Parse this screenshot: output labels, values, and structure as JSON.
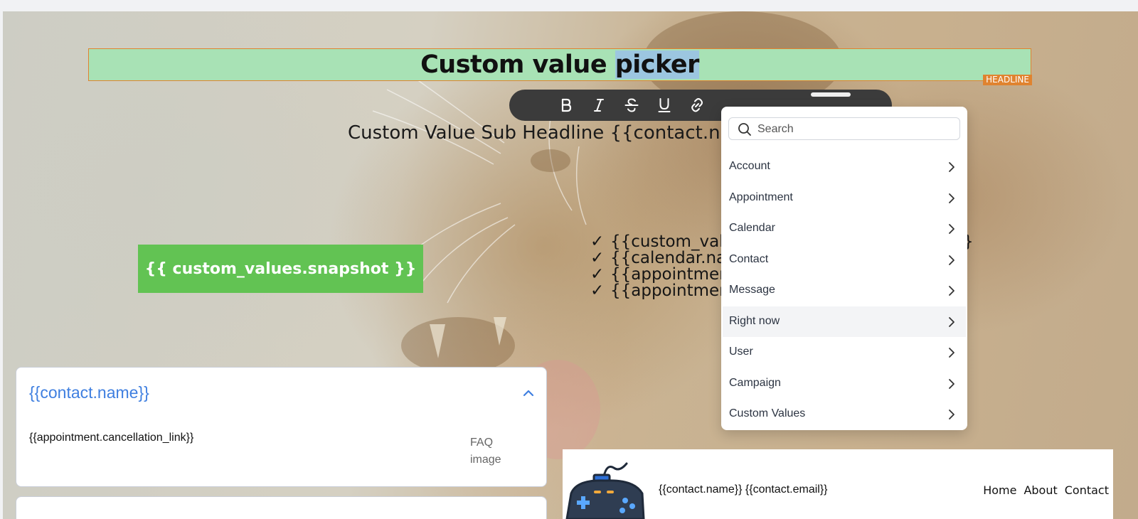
{
  "headline": {
    "text_before": "Custom value ",
    "text_selected": "picker",
    "tag": "HEADLINE"
  },
  "toolbar": {
    "buttons": [
      "bold-icon",
      "italic-icon",
      "strikethrough-icon",
      "underline-icon",
      "link-icon"
    ]
  },
  "subheadline": "Custom Value Sub Headline {{contact.na",
  "cta_button": "{{ custom_values.snapshot }}",
  "checklist": {
    "mark": "✓",
    "items": [
      {
        "text": "{{custom_valu",
        "end": "}"
      },
      {
        "text": "{{calendar.na",
        "end": ""
      },
      {
        "text": "{{appointmen",
        "end": ""
      },
      {
        "text": "{{appointmen",
        "end": ""
      }
    ]
  },
  "faq": {
    "question": "{{contact.name}}",
    "answer": "{{appointment.cancellation_link}}",
    "image_alt": "FAQ image"
  },
  "footer": {
    "contact": "{{contact.name}} {{contact.email}}",
    "nav": [
      "Home",
      "About",
      "Contact"
    ]
  },
  "picker": {
    "search_placeholder": "Search",
    "items": [
      "Account",
      "Appointment",
      "Calendar",
      "Contact",
      "Message",
      "Right now",
      "User",
      "Campaign",
      "Custom Values"
    ],
    "active_item": "Right now"
  },
  "colors": {
    "headline_bg": "#a8e2b5",
    "selection_border": "#e0832f",
    "cta_bg": "#62c353",
    "faq_link": "#3f7fe0"
  }
}
